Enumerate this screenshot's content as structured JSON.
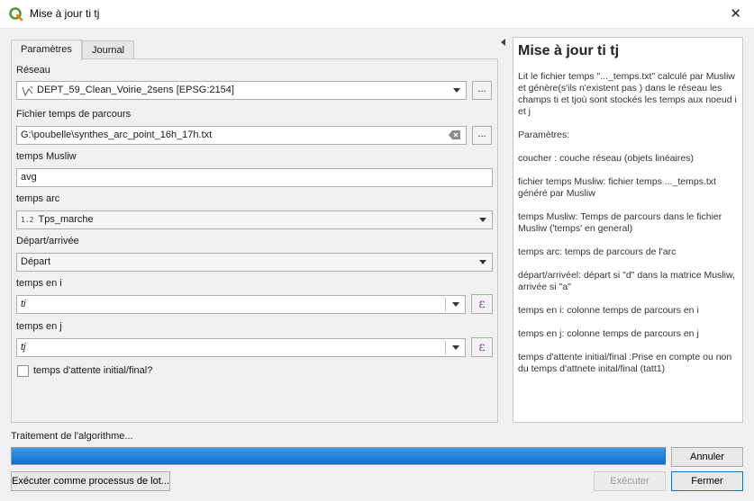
{
  "window": {
    "title": "Mise à jour ti tj"
  },
  "tabs": [
    {
      "label": "Paramètres"
    },
    {
      "label": "Journal"
    }
  ],
  "form": {
    "reseau_label": "Réseau",
    "reseau_value": "DEPT_59_Clean_Voirie_2sens [EPSG:2154]",
    "fichier_label": "Fichier temps de parcours",
    "fichier_value": "G:\\poubelle\\synthes_arc_point_16h_17h.txt",
    "musliw_label": "temps Musliw",
    "musliw_value": "avg",
    "arc_label": "temps arc",
    "arc_type_icon": "1.2",
    "arc_value": "Tps_marche",
    "depart_label": "Départ/arrivée",
    "depart_value": "Départ",
    "ti_label": "temps en i",
    "ti_value": "ti",
    "tj_label": "temps en j",
    "tj_value": "tj",
    "attente_label": "temps d'attente initial/final?",
    "browse": "...",
    "expr": "ε"
  },
  "help": {
    "title": "Mise à jour ti tj",
    "paragraphs": [
      "Lit le fichier temps \"..._temps.txt\" calculé par Musliw et génère(s'ils n'existent pas ) dans le réseau les champs ti et tjoù sont stockés les temps aux noeud i et j",
      "Paramètres:",
      "coucher : couche réseau (objets linéaires)",
      "fichier temps Musliw: fichier temps ..._temps.txt généré par Musliw",
      "temps Musliw: Temps de parcours dans le fichier Musliw ('temps' en general)",
      "temps arc: temps de parcours de l'arc",
      "départ/arrivéel: départ si \"d\" dans la matrice Musliw, arrivée si \"a\"",
      "temps en i: colonne temps de parcours en i",
      "temps en j: colonne temps de parcours en j",
      "temps d'attente initial/final :Prise en compte ou non du temps d'attnete inital/final (tatt1)"
    ]
  },
  "footer": {
    "status": "Traitement de l'algorithme...",
    "progress": 100,
    "cancel": "Annuler",
    "batch": "Exécuter comme processus de lot...",
    "run": "Exécuter",
    "close": "Fermer"
  }
}
